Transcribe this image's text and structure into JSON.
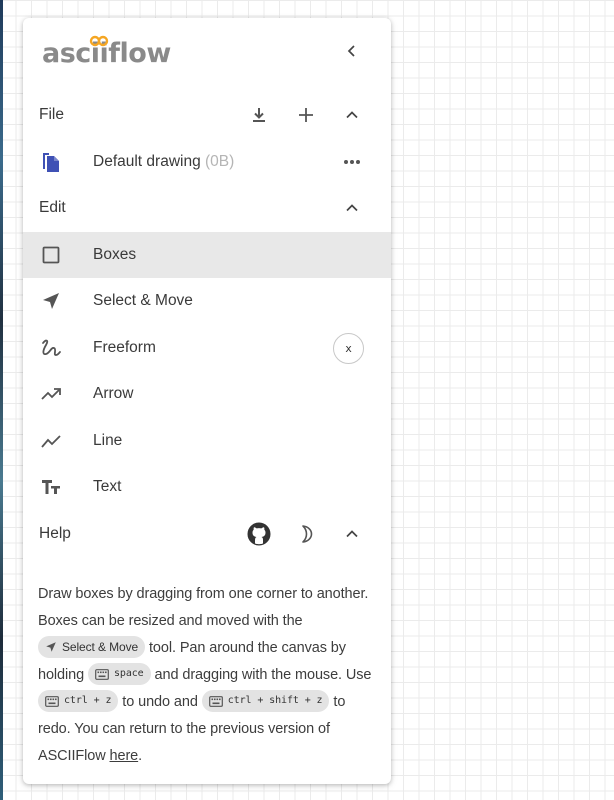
{
  "app": {
    "logo_text": "asciiflow"
  },
  "file_section": {
    "label": "File",
    "drawing": {
      "name": "Default drawing",
      "size": "(0B)"
    }
  },
  "edit_section": {
    "label": "Edit",
    "tools": [
      {
        "label": "Boxes",
        "icon": "box-outline-icon",
        "selected": true
      },
      {
        "label": "Select & Move",
        "icon": "navigation-arrow-icon",
        "selected": false
      },
      {
        "label": "Freeform",
        "icon": "freeform-gesture-icon",
        "selected": false,
        "shortcut": "x"
      },
      {
        "label": "Arrow",
        "icon": "trending-up-arrow-icon",
        "selected": false
      },
      {
        "label": "Line",
        "icon": "show-chart-line-icon",
        "selected": false
      },
      {
        "label": "Text",
        "icon": "text-fields-icon",
        "selected": false
      }
    ]
  },
  "help_section": {
    "label": "Help",
    "text_1": "Draw boxes by dragging from one corner to another. Boxes can be resized and moved with the ",
    "chip_select_move": "Select & Move",
    "text_2": " tool. Pan around the canvas by holding ",
    "chip_space": "space",
    "text_3": " and dragging with the mouse. Use ",
    "chip_undo": "ctrl + z",
    "text_4": " to undo and ",
    "chip_redo": "ctrl + shift + z",
    "text_5": " to redo. You can return to the previous version of ASCIIFlow ",
    "link_here": "here",
    "text_6": "."
  },
  "colors": {
    "accent_drawing_icon": "#3f51b5",
    "logo_orange": "#f5a623",
    "logo_gray": "#8a8a8a",
    "selected_row": "#e8e8e8"
  }
}
